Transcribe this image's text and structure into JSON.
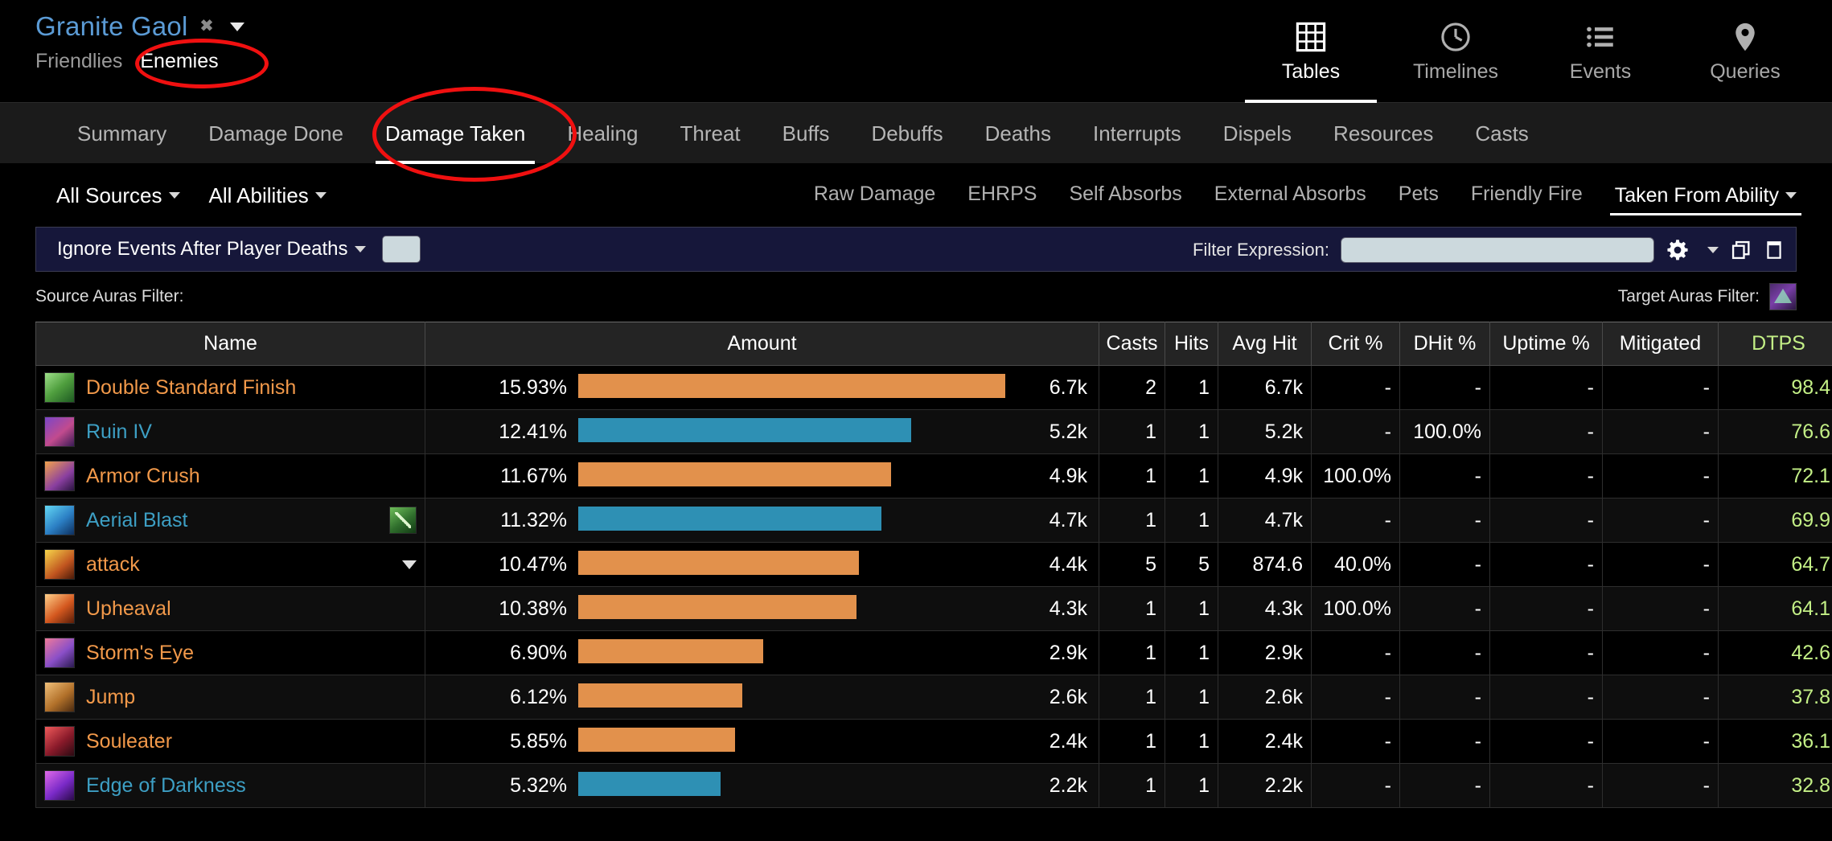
{
  "header": {
    "report_title": "Granite Gaol",
    "boss_icon": "skull-icon",
    "dropdown_icon": "chevron-down-icon",
    "side_tabs": [
      {
        "label": "Friendlies",
        "active": false
      },
      {
        "label": "Enemies",
        "active": true
      }
    ],
    "main_nav": [
      {
        "label": "Tables",
        "icon": "grid-icon",
        "active": true
      },
      {
        "label": "Timelines",
        "icon": "clock-icon",
        "active": false
      },
      {
        "label": "Events",
        "icon": "list-icon",
        "active": false
      },
      {
        "label": "Queries",
        "icon": "map-pin-icon",
        "active": false
      }
    ]
  },
  "tabs": [
    {
      "label": "Summary",
      "active": false
    },
    {
      "label": "Damage Done",
      "active": false
    },
    {
      "label": "Damage Taken",
      "active": true
    },
    {
      "label": "Healing",
      "active": false
    },
    {
      "label": "Threat",
      "active": false
    },
    {
      "label": "Buffs",
      "active": false
    },
    {
      "label": "Debuffs",
      "active": false
    },
    {
      "label": "Deaths",
      "active": false
    },
    {
      "label": "Interrupts",
      "active": false
    },
    {
      "label": "Dispels",
      "active": false
    },
    {
      "label": "Resources",
      "active": false
    },
    {
      "label": "Casts",
      "active": false
    }
  ],
  "options": {
    "selectors": [
      {
        "label": "All Sources",
        "icon": "chevron-down-icon"
      },
      {
        "label": "All Abilities",
        "icon": "chevron-down-icon"
      }
    ],
    "toggles": [
      {
        "label": "Raw Damage",
        "active": false,
        "has_caret": false
      },
      {
        "label": "EHRPS",
        "active": false,
        "has_caret": false
      },
      {
        "label": "Self Absorbs",
        "active": false,
        "has_caret": false
      },
      {
        "label": "External Absorbs",
        "active": false,
        "has_caret": false
      },
      {
        "label": "Pets",
        "active": false,
        "has_caret": false
      },
      {
        "label": "Friendly Fire",
        "active": false,
        "has_caret": false
      },
      {
        "label": "Taken From Ability",
        "active": true,
        "has_caret": true
      }
    ]
  },
  "filter_bar": {
    "ignore_deaths_label": "Ignore Events After Player Deaths",
    "ignore_deaths_caret": "chevron-down-icon",
    "checkbox_checked": false,
    "filter_expression_label": "Filter Expression:",
    "filter_expression_value": "",
    "filter_expression_placeholder": "",
    "gear_icon": "gear-icon",
    "gear_caret": "chevron-down-icon",
    "copy_icon": "duplicate-window-icon",
    "panel_icon": "single-panel-icon"
  },
  "auras": {
    "source_label": "Source Auras Filter:",
    "target_label": "Target Auras Filter:",
    "target_icon": "aura-buff-icon"
  },
  "table": {
    "columns": [
      "Name",
      "Amount",
      "Casts",
      "Hits",
      "Avg Hit",
      "Crit %",
      "DHit %",
      "Uptime %",
      "Mitigated",
      "DTPS",
      "+"
    ],
    "rows": [
      {
        "icon": "foot-kick-icon",
        "name": "Double Standard Finish",
        "name_color": "orange",
        "pct": "15.93%",
        "bar_pct": 15.93,
        "bar_color": "orange",
        "amount": "6.7k",
        "casts": "2",
        "hits": "1",
        "avg_hit": "6.7k",
        "crit": "-",
        "dhit": "-",
        "uptime": "-",
        "mitigated": "-",
        "dtps": "98.4",
        "plus": "+",
        "extra_icon": null,
        "caret": false
      },
      {
        "icon": "hammer-magic-icon",
        "name": "Ruin IV",
        "name_color": "blue",
        "pct": "12.41%",
        "bar_pct": 12.41,
        "bar_color": "blue",
        "amount": "5.2k",
        "casts": "1",
        "hits": "1",
        "avg_hit": "5.2k",
        "crit": "-",
        "dhit": "100.0%",
        "uptime": "-",
        "mitigated": "-",
        "dtps": "76.6",
        "plus": "+",
        "extra_icon": null,
        "caret": false
      },
      {
        "icon": "sword-slash-icon",
        "name": "Armor Crush",
        "name_color": "orange",
        "pct": "11.67%",
        "bar_pct": 11.67,
        "bar_color": "orange",
        "amount": "4.9k",
        "casts": "1",
        "hits": "1",
        "avg_hit": "4.9k",
        "crit": "100.0%",
        "dhit": "-",
        "uptime": "-",
        "mitigated": "-",
        "dtps": "72.1",
        "plus": "+",
        "extra_icon": null,
        "caret": false
      },
      {
        "icon": "wind-figure-icon",
        "name": "Aerial Blast",
        "name_color": "blue",
        "pct": "11.32%",
        "bar_pct": 11.32,
        "bar_color": "blue",
        "amount": "4.7k",
        "casts": "1",
        "hits": "1",
        "avg_hit": "4.7k",
        "crit": "-",
        "dhit": "-",
        "uptime": "-",
        "mitigated": "-",
        "dtps": "69.9",
        "plus": "+",
        "extra_icon": "green-wind-icon",
        "caret": false
      },
      {
        "icon": "auto-attack-icon",
        "name": "attack",
        "name_color": "orange",
        "pct": "10.47%",
        "bar_pct": 10.47,
        "bar_color": "orange",
        "amount": "4.4k",
        "casts": "5",
        "hits": "5",
        "avg_hit": "874.6",
        "crit": "40.0%",
        "dhit": "-",
        "uptime": "-",
        "mitigated": "-",
        "dtps": "64.7",
        "plus": "+",
        "extra_icon": null,
        "caret": true
      },
      {
        "icon": "upheaval-icon",
        "name": "Upheaval",
        "name_color": "orange",
        "pct": "10.38%",
        "bar_pct": 10.38,
        "bar_color": "orange",
        "amount": "4.3k",
        "casts": "1",
        "hits": "1",
        "avg_hit": "4.3k",
        "crit": "100.0%",
        "dhit": "-",
        "uptime": "-",
        "mitigated": "-",
        "dtps": "64.1",
        "plus": "+",
        "extra_icon": null,
        "caret": false
      },
      {
        "icon": "storms-eye-icon",
        "name": "Storm's Eye",
        "name_color": "orange",
        "pct": "6.90%",
        "bar_pct": 6.9,
        "bar_color": "orange",
        "amount": "2.9k",
        "casts": "1",
        "hits": "1",
        "avg_hit": "2.9k",
        "crit": "-",
        "dhit": "-",
        "uptime": "-",
        "mitigated": "-",
        "dtps": "42.6",
        "plus": "+",
        "extra_icon": null,
        "caret": false
      },
      {
        "icon": "jump-icon",
        "name": "Jump",
        "name_color": "orange",
        "pct": "6.12%",
        "bar_pct": 6.12,
        "bar_color": "orange",
        "amount": "2.6k",
        "casts": "1",
        "hits": "1",
        "avg_hit": "2.6k",
        "crit": "-",
        "dhit": "-",
        "uptime": "-",
        "mitigated": "-",
        "dtps": "37.8",
        "plus": "+",
        "extra_icon": null,
        "caret": false
      },
      {
        "icon": "souleater-icon",
        "name": "Souleater",
        "name_color": "orange",
        "pct": "5.85%",
        "bar_pct": 5.85,
        "bar_color": "orange",
        "amount": "2.4k",
        "casts": "1",
        "hits": "1",
        "avg_hit": "2.4k",
        "crit": "-",
        "dhit": "-",
        "uptime": "-",
        "mitigated": "-",
        "dtps": "36.1",
        "plus": "+",
        "extra_icon": null,
        "caret": false
      },
      {
        "icon": "edge-darkness-icon",
        "name": "Edge of Darkness",
        "name_color": "blue",
        "pct": "5.32%",
        "bar_pct": 5.32,
        "bar_color": "blue",
        "amount": "2.2k",
        "casts": "1",
        "hits": "1",
        "avg_hit": "2.2k",
        "crit": "-",
        "dhit": "-",
        "uptime": "-",
        "mitigated": "-",
        "dtps": "32.8",
        "plus": "+",
        "extra_icon": null,
        "caret": false
      }
    ]
  },
  "annotations": {
    "accent_color": "#f01010",
    "circled": [
      "Enemies",
      "Damage Taken"
    ]
  },
  "colors": {
    "bar_orange": "#e2914c",
    "bar_blue": "#2e90b4",
    "name_orange": "#f2994a",
    "name_blue": "#3d9fc4",
    "dtps_green": "#c3ef86",
    "title_blue": "#5b9bd5",
    "filter_bar_bg": "#16173a"
  }
}
